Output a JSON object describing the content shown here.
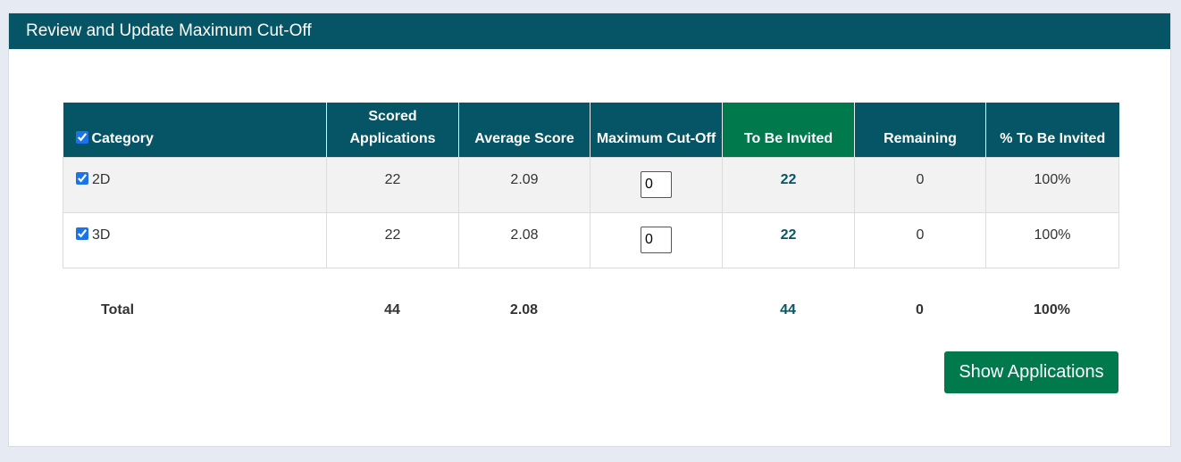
{
  "panel": {
    "title": "Review and Update Maximum Cut-Off"
  },
  "table": {
    "headers": {
      "category": "Category",
      "scored_line1": "Scored",
      "scored_line2": "Applications",
      "average": "Average Score",
      "cutoff": "Maximum Cut-Off",
      "invited": "To Be Invited",
      "remaining": "Remaining",
      "percent": "% To Be Invited"
    },
    "select_all_checked": true,
    "rows": [
      {
        "checked": true,
        "category": "2D",
        "scored": "22",
        "average": "2.09",
        "cutoff": "0",
        "invited": "22",
        "remaining": "0",
        "percent": "100%"
      },
      {
        "checked": true,
        "category": "3D",
        "scored": "22",
        "average": "2.08",
        "cutoff": "0",
        "invited": "22",
        "remaining": "0",
        "percent": "100%"
      }
    ]
  },
  "totals": {
    "label": "Total",
    "scored": "44",
    "average": "2.08",
    "invited": "44",
    "remaining": "0",
    "percent": "100%"
  },
  "actions": {
    "show_applications": "Show Applications"
  },
  "colors": {
    "header_teal": "#055566",
    "invite_green": "#007a4d",
    "page_background": "#e6eaf3"
  }
}
